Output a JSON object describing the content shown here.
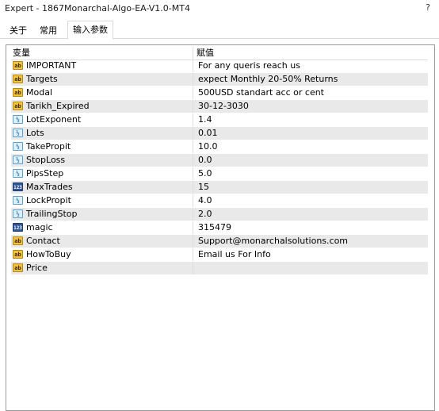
{
  "window": {
    "title": "Expert - 1867Monarchal-Algo-EA-V1.0-MT4",
    "help_label": "?"
  },
  "tabs": [
    {
      "label": "关于",
      "active": false
    },
    {
      "label": "常用",
      "active": false
    },
    {
      "label": "输入参数",
      "active": true
    }
  ],
  "table": {
    "headers": {
      "variable": "变量",
      "value": "赋值"
    },
    "rows": [
      {
        "type": "ab",
        "icon_text": "ab",
        "name": "IMPORTANT",
        "value": " For any queris reach us"
      },
      {
        "type": "ab",
        "icon_text": "ab",
        "name": "Targets",
        "value": "expect Monthly 20-50% Returns"
      },
      {
        "type": "ab",
        "icon_text": "ab",
        "name": "Modal",
        "value": "500USD standart acc or cent"
      },
      {
        "type": "ab",
        "icon_text": "ab",
        "name": "Tarikh_Expired",
        "value": "30-12-3030"
      },
      {
        "type": "v2",
        "icon_text": "½",
        "name": "LotExponent",
        "value": "1.4"
      },
      {
        "type": "v2",
        "icon_text": "½",
        "name": "Lots",
        "value": "0.01"
      },
      {
        "type": "v2",
        "icon_text": "½",
        "name": "TakePropit",
        "value": "10.0"
      },
      {
        "type": "v2",
        "icon_text": "½",
        "name": "StopLoss",
        "value": "0.0"
      },
      {
        "type": "v2",
        "icon_text": "½",
        "name": "PipsStep",
        "value": "5.0"
      },
      {
        "type": "n123",
        "icon_text": "123",
        "name": "MaxTrades",
        "value": "15"
      },
      {
        "type": "v2",
        "icon_text": "½",
        "name": "LockPropit",
        "value": "4.0"
      },
      {
        "type": "v2",
        "icon_text": "½",
        "name": "TrailingStop",
        "value": "2.0"
      },
      {
        "type": "n123",
        "icon_text": "123",
        "name": "magic",
        "value": "315479"
      },
      {
        "type": "ab",
        "icon_text": "ab",
        "name": "Contact",
        "value": "Support@monarchalsolutions.com"
      },
      {
        "type": "ab",
        "icon_text": "ab",
        "name": "HowToBuy",
        "value": "Email us For Info"
      },
      {
        "type": "ab",
        "icon_text": "ab",
        "name": "Price",
        "value": ""
      }
    ]
  }
}
